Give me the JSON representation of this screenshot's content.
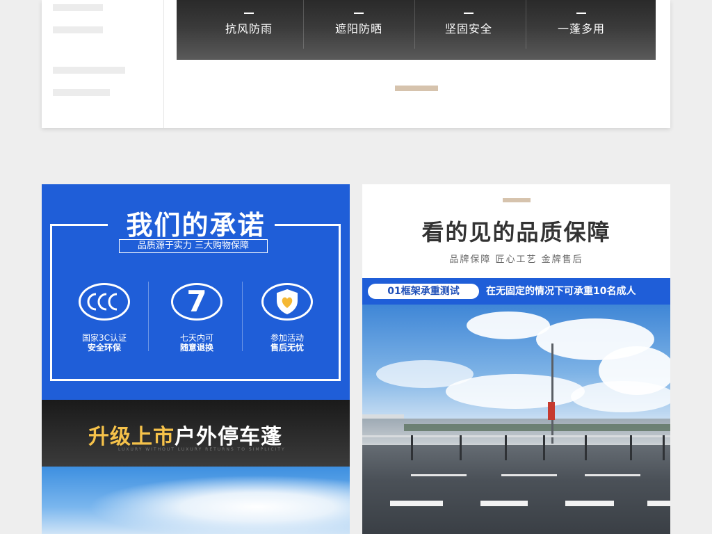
{
  "top_section": {
    "features": [
      "抗风防雨",
      "遮阳防晒",
      "坚固安全",
      "一蓬多用"
    ]
  },
  "promise": {
    "title": "我们的承诺",
    "subtitle": "品质源于实力 三大购物保障",
    "badges": [
      {
        "icon": "ccc-certification-icon",
        "glyph": "CCC",
        "line1": "国家3C认证",
        "line2": "安全环保"
      },
      {
        "icon": "seven-days-return-icon",
        "glyph": "7",
        "line1": "七天内可",
        "line2": "随意退换"
      },
      {
        "icon": "shield-heart-icon",
        "glyph": "",
        "line1": "参加活动",
        "line2": "售后无忧"
      }
    ],
    "colors": {
      "primary": "#1f5ed8"
    }
  },
  "upgrade": {
    "title_gold": "升级上市",
    "title_white": "户外停车蓬",
    "tagline": "LUXURY WITHOUT LUXURY RETURNS TO SIMPLICITY"
  },
  "quality": {
    "title": "看的见的品质保障",
    "subtitle": "品牌保障 匠心工艺 金牌售后",
    "test_tag": "01框架承重测试",
    "test_desc": "在无固定的情况下可承重10名成人"
  }
}
